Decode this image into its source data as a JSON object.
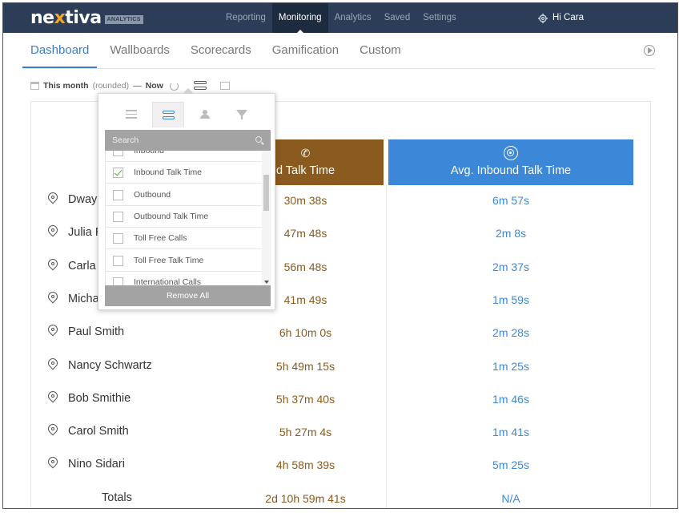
{
  "brand": {
    "name_pre": "ne",
    "name_x": "x",
    "name_post": "tiva",
    "badge": "ANALYTICS",
    "accent": "#f4a52a",
    "bar_color": "#2c3e57"
  },
  "topnav": [
    {
      "label": "Reporting",
      "active": false
    },
    {
      "label": "Monitoring",
      "active": true
    },
    {
      "label": "Analytics",
      "active": false
    },
    {
      "label": "Saved",
      "active": false
    },
    {
      "label": "Settings",
      "active": false
    }
  ],
  "user": {
    "greeting": "Hi Cara",
    "icon": "gear-icon"
  },
  "tabs": [
    {
      "label": "Dashboard",
      "active": true
    },
    {
      "label": "Wallboards",
      "active": false
    },
    {
      "label": "Scorecards",
      "active": false
    },
    {
      "label": "Gamification",
      "active": false
    },
    {
      "label": "Custom",
      "active": false
    }
  ],
  "daterange": {
    "period": "This month",
    "qualifier": "(rounded)",
    "dash": "—",
    "end": "Now"
  },
  "columns": [
    {
      "label": "Inbound Talk Time",
      "visible_label": "d Talk Time",
      "color": "#8a5a1e",
      "icon": "phone-clock-icon"
    },
    {
      "label": "Avg. Inbound Talk Time",
      "color": "#3d87d8",
      "icon": "target-icon"
    }
  ],
  "rows": [
    {
      "name": "Dway",
      "v1": "30m 38s",
      "v2": "6m 57s"
    },
    {
      "name": "Julia R",
      "v1": "47m 48s",
      "v2": "2m 8s"
    },
    {
      "name": "Carla",
      "v1": "56m 48s",
      "v2": "2m 37s"
    },
    {
      "name": "Micha",
      "v1": "41m 49s",
      "v2": "1m 59s"
    },
    {
      "name": "Paul Smith",
      "v1": "6h 10m 0s",
      "v2": "2m 28s"
    },
    {
      "name": "Nancy Schwartz",
      "v1": "5h 49m 15s",
      "v2": "1m 25s"
    },
    {
      "name": "Bob Smithie",
      "v1": "5h 37m 40s",
      "v2": "1m 46s"
    },
    {
      "name": "Carol Smith",
      "v1": "5h 27m 4s",
      "v2": "1m 41s"
    },
    {
      "name": "Nino Sidari",
      "v1": "4h 58m 39s",
      "v2": "5m 25s"
    }
  ],
  "totals": {
    "label": "Totals",
    "v1": "2d 10h 59m 41s",
    "v2": "N/A"
  },
  "popover": {
    "tabs": [
      "list-icon",
      "sliders-icon",
      "people-icon",
      "filter-icon"
    ],
    "search_placeholder": "Search",
    "items": [
      {
        "label": "Inbound",
        "checked": false
      },
      {
        "label": "Inbound Talk Time",
        "checked": true
      },
      {
        "label": "Outbound",
        "checked": false
      },
      {
        "label": "Outbound Talk Time",
        "checked": false
      },
      {
        "label": "Toll Free Calls",
        "checked": false
      },
      {
        "label": "Toll Free Talk Time",
        "checked": false
      },
      {
        "label": "International Calls",
        "checked": false
      }
    ],
    "remove_all": "Remove All"
  }
}
